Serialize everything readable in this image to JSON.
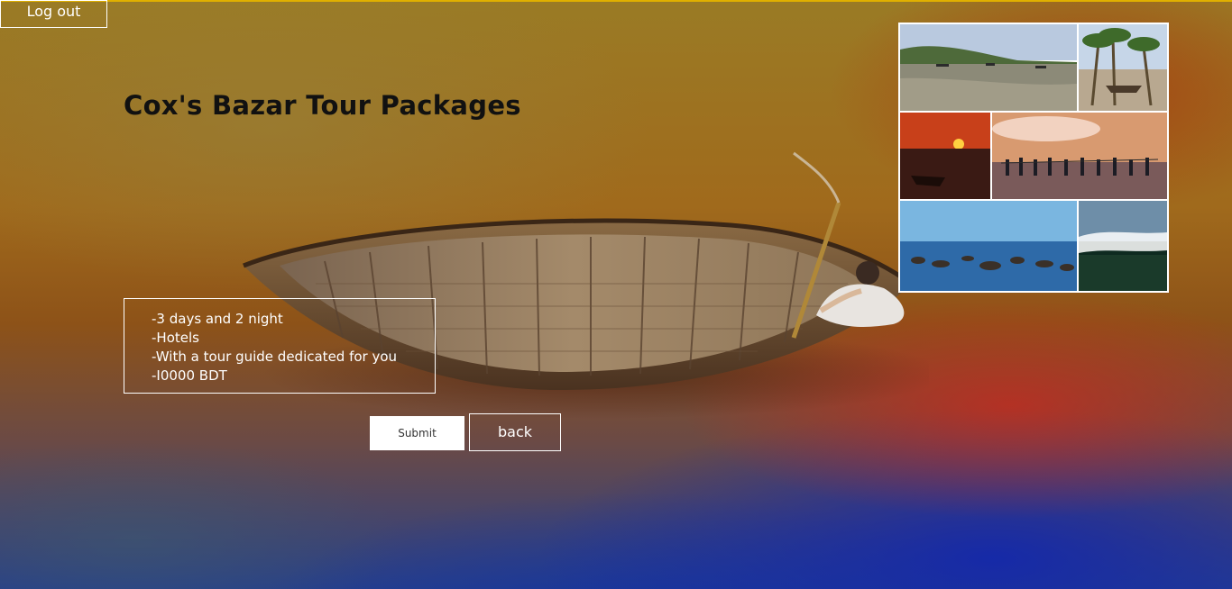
{
  "header": {
    "logout_label": "Log out"
  },
  "main": {
    "title": "Cox's Bazar Tour Packages",
    "package_details": [
      "-3 days and 2 night",
      "-Hotels",
      "-With a tour guide dedicated for you",
      "-I0000 BDT"
    ],
    "submit_label": "Submit",
    "back_label": "back"
  },
  "collage": {
    "tiles": [
      "beach-photo",
      "palm-boat-photo",
      "sunset-boat-photo",
      "fishermen-photo",
      "rocky-shore-photo",
      "sky-reflection-photo"
    ]
  },
  "colors": {
    "top_line": "#e0b000",
    "title": "#111111",
    "border": "#ffffff"
  }
}
